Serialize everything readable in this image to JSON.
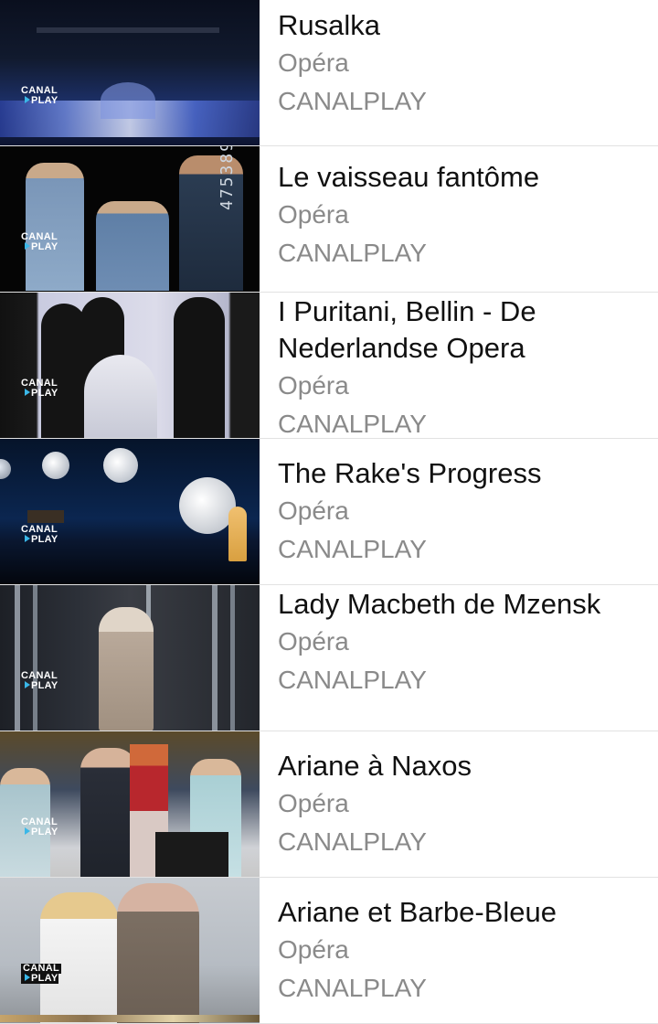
{
  "items": [
    {
      "title": "Rusalka",
      "genre": "Opéra",
      "provider": "CANALPLAY"
    },
    {
      "title": "Le vaisseau fantôme",
      "genre": "Opéra",
      "provider": "CANALPLAY"
    },
    {
      "title": "I Puritani, Bellin - De Nederlandse Opera",
      "genre": "Opéra",
      "provider": "CANALPLAY"
    },
    {
      "title": "The Rake's Progress",
      "genre": "Opéra",
      "provider": "CANALPLAY"
    },
    {
      "title": "Lady Macbeth de Mzensk",
      "genre": "Opéra",
      "provider": "CANALPLAY"
    },
    {
      "title": "Ariane à Naxos",
      "genre": "Opéra",
      "provider": "CANALPLAY"
    },
    {
      "title": "Ariane et Barbe-Bleue",
      "genre": "Opéra",
      "provider": "CANALPLAY"
    }
  ],
  "logo": {
    "line1": "CANAL",
    "line2": "PLAY"
  },
  "thumb_overlay_text": "475389"
}
